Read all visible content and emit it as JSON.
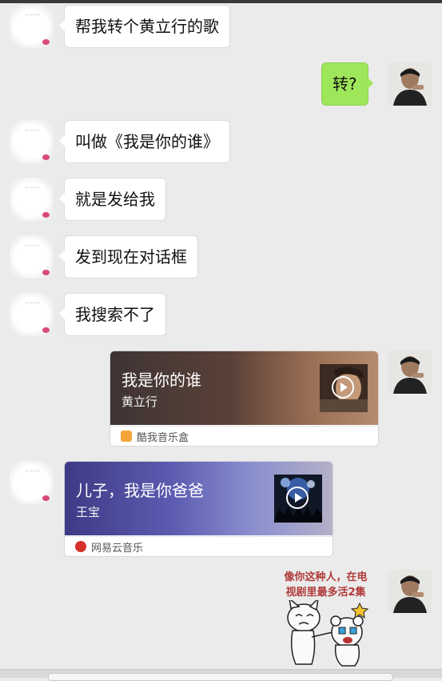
{
  "messages": [
    {
      "text": "帮我转个黄立行的歌"
    },
    {
      "text": "转?"
    },
    {
      "text": "叫做《我是你的谁》"
    },
    {
      "text": "就是发给我"
    },
    {
      "text": "发到现在对话框"
    },
    {
      "text": "我搜索不了"
    }
  ],
  "music_cards": [
    {
      "title": "我是你的谁",
      "artist": "黄立行",
      "app": "酷我音乐盒"
    },
    {
      "title": "儿子，我是你爸爸",
      "artist": "王宝",
      "app": "网易云音乐"
    }
  ],
  "sticker": {
    "line1": "像你这种人，在电",
    "line2": "视剧里最多活2集"
  },
  "colors": {
    "background": "#ebebeb",
    "sent_bubble": "#9fe75a",
    "received_bubble": "#ffffff",
    "netease_red": "#d4312a",
    "kuwo_orange": "#f3a53a"
  }
}
